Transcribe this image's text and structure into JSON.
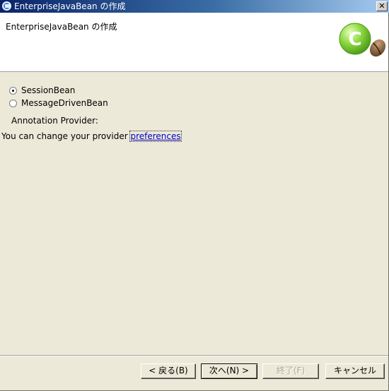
{
  "window": {
    "title": "EnterpriseJavaBean の作成"
  },
  "banner": {
    "title": "EnterpriseJavaBean の作成",
    "logo_letter": "C"
  },
  "form": {
    "bean_types": [
      {
        "label": "SessionBean",
        "selected": true
      },
      {
        "label": "MessageDrivenBean",
        "selected": false
      }
    ],
    "annotation_label": "Annotation Provider:",
    "change_text": "You can change your provider ",
    "preferences_link": "preferences"
  },
  "buttons": {
    "back": "< 戻る(B)",
    "next": "次へ(N) >",
    "finish": "終了(F)",
    "cancel": "キャンセル"
  },
  "colors": {
    "title_bar": "#0a246a",
    "dialog_bg": "#ece9d8",
    "link": "#0000cc",
    "logo_green": "#7fd13b"
  }
}
